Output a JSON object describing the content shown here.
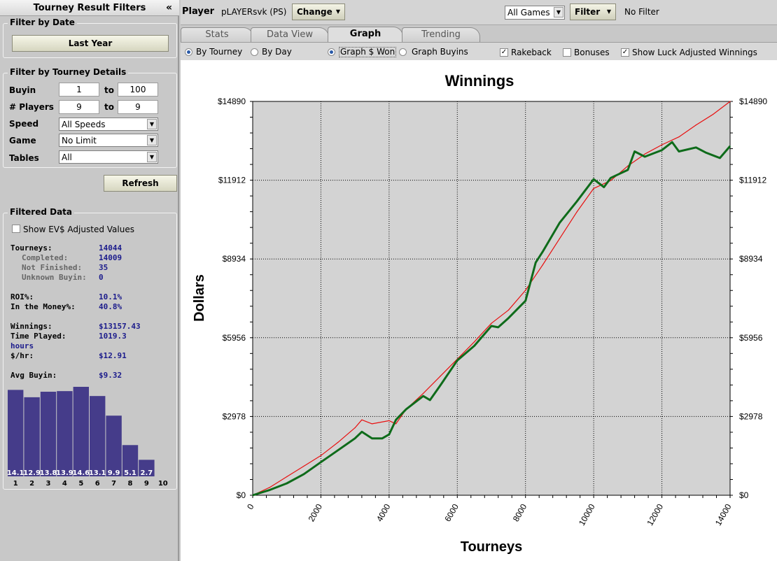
{
  "left": {
    "title": "Tourney Result Filters",
    "collapse_icon": "«",
    "date_group": {
      "legend": "Filter by Date",
      "button": "Last Year"
    },
    "details_group": {
      "legend": "Filter by Tourney Details",
      "buyin_label": "Buyin",
      "buyin_from": "1",
      "to1": "to",
      "buyin_to": "100",
      "players_label": "# Players",
      "players_from": "9",
      "to2": "to",
      "players_to": "9",
      "speed_label": "Speed",
      "speed_value": "All Speeds",
      "game_label": "Game",
      "game_value": "No Limit",
      "tables_label": "Tables",
      "tables_value": "All"
    },
    "refresh": "Refresh",
    "filtered": {
      "legend": "Filtered Data",
      "ev_checkbox": "Show EV$ Adjusted Values",
      "stats": [
        {
          "k": "Tourneys:",
          "v": "14044"
        },
        {
          "k": "Completed:",
          "v": "14009"
        },
        {
          "k": "Not Finished:",
          "v": "35"
        },
        {
          "k": "Unknown Buyin:",
          "v": "0"
        },
        {
          "k": "ROI%:",
          "v": "10.1%"
        },
        {
          "k": "In the Money%:",
          "v": "40.8%"
        },
        {
          "k": "Winnings:",
          "v": "$13157.43"
        },
        {
          "k": "Time Played:",
          "v": "1019.3"
        },
        {
          "k": "hours",
          "v": ""
        },
        {
          "k": "$/hr:",
          "v": "$12.91"
        },
        {
          "k": "Avg Buyin:",
          "v": "$9.32"
        }
      ]
    }
  },
  "finish_chart": {
    "type": "bar",
    "categories": [
      "1",
      "2",
      "3",
      "4",
      "5",
      "6",
      "7",
      "8",
      "9",
      "10"
    ],
    "values": [
      14.1,
      12.9,
      13.8,
      13.9,
      14.6,
      13.1,
      9.9,
      5.1,
      2.7,
      null
    ],
    "labels": [
      "14.1",
      "12.9",
      "13.8",
      "13.9",
      "14.6",
      "13.1",
      "9.9",
      "5.1",
      "2.7",
      ""
    ],
    "color": "#453c8a"
  },
  "topbar": {
    "player_label": "Player",
    "player_name": "pLAYERsvk (PS)",
    "change": "Change",
    "games_value": "All Games",
    "filter": "Filter",
    "filter_status": "No Filter"
  },
  "tabs": [
    "Stats",
    "Data View",
    "Graph",
    "Trending"
  ],
  "options": {
    "by_tourney": "By Tourney",
    "by_day": "By Day",
    "graph_won": "Graph $ Won",
    "graph_buyins": "Graph Buyins",
    "rakeback": "Rakeback",
    "bonuses": "Bonuses",
    "luck": "Show Luck Adjusted Winnings"
  },
  "colors": {
    "red": "#e81010",
    "green": "#0e6b1a",
    "plot_bg": "#d3d3d3"
  },
  "chart_data": {
    "type": "line",
    "title": "Winnings",
    "xlabel": "Tourneys",
    "ylabel": "Dollars",
    "xlim": [
      0,
      14000
    ],
    "ylim": [
      0,
      14890
    ],
    "xticks": [
      0,
      2000,
      4000,
      6000,
      8000,
      10000,
      12000,
      14000
    ],
    "yticks": [
      0,
      2978,
      5956,
      8934,
      11912,
      14890
    ],
    "ytick_labels": [
      "$0",
      "$2978",
      "$5956",
      "$8934",
      "$11912",
      "$14890"
    ],
    "grid": true,
    "series": [
      {
        "color": "#e81010",
        "x": [
          0,
          500,
          1000,
          1500,
          2000,
          2500,
          3000,
          3200,
          3500,
          4000,
          4200,
          4500,
          5000,
          5500,
          6000,
          6500,
          7000,
          7500,
          8000,
          8500,
          9000,
          9500,
          10000,
          10500,
          11000,
          11500,
          12000,
          12500,
          13000,
          13500,
          14000
        ],
        "y": [
          0,
          300,
          700,
          1100,
          1500,
          2000,
          2550,
          2850,
          2700,
          2820,
          2700,
          3250,
          3850,
          4500,
          5150,
          5800,
          6500,
          7000,
          7750,
          8700,
          9700,
          10700,
          11600,
          11900,
          12450,
          12900,
          13250,
          13550,
          14000,
          14400,
          14890
        ]
      },
      {
        "color": "#0e6b1a",
        "x": [
          0,
          500,
          1000,
          1500,
          2000,
          2500,
          3000,
          3200,
          3500,
          3800,
          4000,
          4200,
          4500,
          5000,
          5200,
          5500,
          6000,
          6500,
          7000,
          7200,
          7500,
          8000,
          8300,
          8500,
          9000,
          9500,
          10000,
          10300,
          10500,
          11000,
          11200,
          11500,
          12000,
          12300,
          12500,
          13000,
          13300,
          13700,
          14000
        ],
        "y": [
          0,
          200,
          450,
          800,
          1250,
          1700,
          2150,
          2400,
          2150,
          2150,
          2300,
          2850,
          3250,
          3750,
          3600,
          4150,
          5100,
          5650,
          6400,
          6350,
          6700,
          7350,
          8800,
          9200,
          10300,
          11100,
          11950,
          11650,
          12000,
          12300,
          13000,
          12800,
          13050,
          13350,
          13000,
          13150,
          12950,
          12750,
          13200
        ]
      }
    ]
  }
}
